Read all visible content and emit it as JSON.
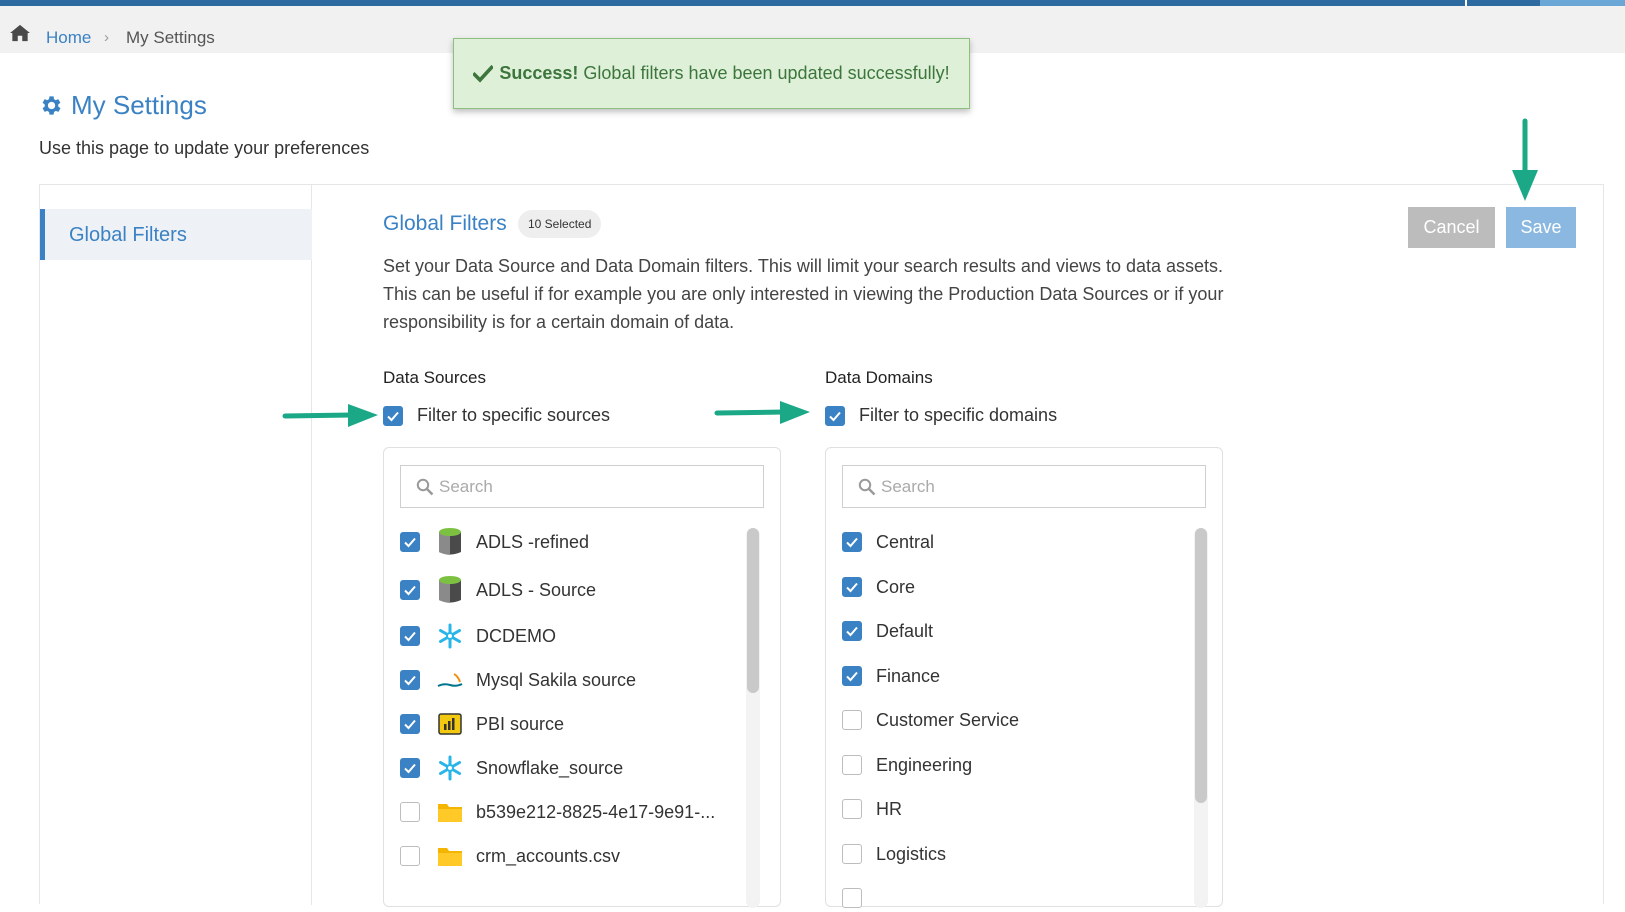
{
  "breadcrumb": {
    "home": "Home",
    "separator": "›",
    "current": "My Settings"
  },
  "toast": {
    "strong": "Success!",
    "message": "Global filters have been updated successfully!"
  },
  "page": {
    "title": "My Settings",
    "subtitle": "Use this page to update your preferences"
  },
  "sidebar": {
    "items": [
      {
        "label": "Global Filters",
        "active": true
      }
    ]
  },
  "section": {
    "title": "Global Filters",
    "badge": "10 Selected",
    "description": "Set your Data Source and Data Domain filters. This will limit your search results and views to data assets. This can be useful if for example you are only interested in viewing the Production Data Sources or if your responsibility is for a certain domain of data."
  },
  "buttons": {
    "cancel": "Cancel",
    "save": "Save"
  },
  "sources": {
    "heading": "Data Sources",
    "filter_label": "Filter to specific sources",
    "filter_checked": true,
    "search_placeholder": "Search",
    "items": [
      {
        "label": "ADLS -refined",
        "checked": true,
        "icon": "adls-storage-icon"
      },
      {
        "label": "ADLS - Source",
        "checked": true,
        "icon": "adls-storage-icon"
      },
      {
        "label": "DCDEMO",
        "checked": true,
        "icon": "snowflake-icon"
      },
      {
        "label": "Mysql Sakila source",
        "checked": true,
        "icon": "mysql-icon"
      },
      {
        "label": "PBI source",
        "checked": true,
        "icon": "powerbi-icon"
      },
      {
        "label": "Snowflake_source",
        "checked": true,
        "icon": "snowflake-icon"
      },
      {
        "label": "b539e212-8825-4e17-9e91-...",
        "checked": false,
        "icon": "folder-icon"
      },
      {
        "label": "crm_accounts.csv",
        "checked": false,
        "icon": "folder-icon"
      }
    ]
  },
  "domains": {
    "heading": "Data Domains",
    "filter_label": "Filter to specific domains",
    "filter_checked": true,
    "search_placeholder": "Search",
    "items": [
      {
        "label": "Central",
        "checked": true
      },
      {
        "label": "Core",
        "checked": true
      },
      {
        "label": "Default",
        "checked": true
      },
      {
        "label": "Finance",
        "checked": true
      },
      {
        "label": "Customer Service",
        "checked": false
      },
      {
        "label": "Engineering",
        "checked": false
      },
      {
        "label": "HR",
        "checked": false
      },
      {
        "label": "Logistics",
        "checked": false
      }
    ]
  },
  "colors": {
    "accent": "#3b82c4",
    "arrow": "#1aa886",
    "success_bg": "#dff0d8",
    "success_text": "#3c763d"
  }
}
